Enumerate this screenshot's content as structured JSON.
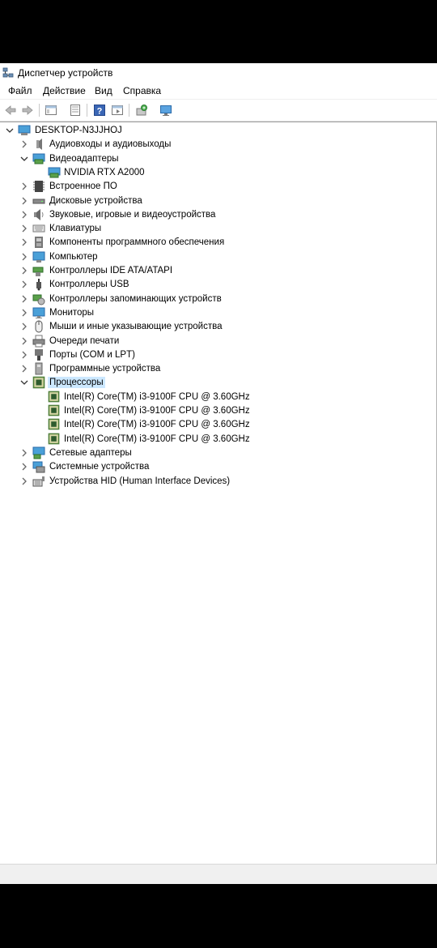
{
  "window": {
    "title": "Диспетчер устройств"
  },
  "menu": [
    "Файл",
    "Действие",
    "Вид",
    "Справка"
  ],
  "toolbar": {
    "buttons": [
      "back-icon",
      "forward-icon",
      "properties-window-icon",
      "list-view-icon",
      "help-icon",
      "console-tree-icon",
      "update-driver-icon",
      "monitor-scan-icon"
    ]
  },
  "tree": {
    "root": "DESKTOP-N3JJHOJ",
    "items": [
      {
        "label": "Аудиовходы и аудиовыходы",
        "icon": "audio-icon",
        "expanded": false,
        "children": []
      },
      {
        "label": "Видеоадаптеры",
        "icon": "display-adapter-icon",
        "expanded": true,
        "children": [
          "NVIDIA RTX A2000"
        ]
      },
      {
        "label": "Встроенное ПО",
        "icon": "firmware-icon",
        "expanded": false,
        "children": []
      },
      {
        "label": "Дисковые устройства",
        "icon": "disk-icon",
        "expanded": false,
        "children": []
      },
      {
        "label": "Звуковые, игровые и видеоустройства",
        "icon": "speaker-icon",
        "expanded": false,
        "children": []
      },
      {
        "label": "Клавиатуры",
        "icon": "keyboard-icon",
        "expanded": false,
        "children": []
      },
      {
        "label": "Компоненты программного обеспечения",
        "icon": "software-component-icon",
        "expanded": false,
        "children": []
      },
      {
        "label": "Компьютер",
        "icon": "computer-icon",
        "expanded": false,
        "children": []
      },
      {
        "label": "Контроллеры IDE ATA/ATAPI",
        "icon": "ide-controller-icon",
        "expanded": false,
        "children": []
      },
      {
        "label": "Контроллеры USB",
        "icon": "usb-icon",
        "expanded": false,
        "children": []
      },
      {
        "label": "Контроллеры запоминающих устройств",
        "icon": "storage-controller-icon",
        "expanded": false,
        "children": []
      },
      {
        "label": "Мониторы",
        "icon": "monitor-icon",
        "expanded": false,
        "children": []
      },
      {
        "label": "Мыши и иные указывающие устройства",
        "icon": "mouse-icon",
        "expanded": false,
        "children": []
      },
      {
        "label": "Очереди печати",
        "icon": "printer-icon",
        "expanded": false,
        "children": []
      },
      {
        "label": "Порты (COM и LPT)",
        "icon": "port-icon",
        "expanded": false,
        "children": []
      },
      {
        "label": "Программные устройства",
        "icon": "software-device-icon",
        "expanded": false,
        "children": []
      },
      {
        "label": "Процессоры",
        "icon": "processor-icon",
        "expanded": true,
        "selected": true,
        "children": [
          "Intel(R) Core(TM) i3-9100F CPU @ 3.60GHz",
          "Intel(R) Core(TM) i3-9100F CPU @ 3.60GHz",
          "Intel(R) Core(TM) i3-9100F CPU @ 3.60GHz",
          "Intel(R) Core(TM) i3-9100F CPU @ 3.60GHz"
        ]
      },
      {
        "label": "Сетевые адаптеры",
        "icon": "network-adapter-icon",
        "expanded": false,
        "children": []
      },
      {
        "label": "Системные устройства",
        "icon": "system-device-icon",
        "expanded": false,
        "children": []
      },
      {
        "label": "Устройства HID (Human Interface Devices)",
        "icon": "hid-icon",
        "expanded": false,
        "children": []
      }
    ]
  },
  "colors": {
    "selection": "#cce8ff",
    "window_bg": "#ffffff",
    "outer_bg": "#000000",
    "status_bg": "#f0f0f0"
  }
}
